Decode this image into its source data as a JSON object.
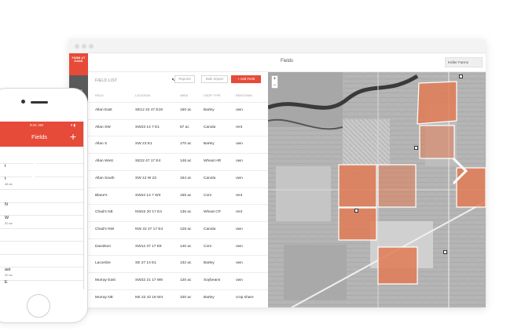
{
  "window": {
    "title": "Fields",
    "farm_selector": "Keller Farms"
  },
  "brand": {
    "logo_text": "FARM AT HAND"
  },
  "list": {
    "title": "FIELD LIST",
    "buttons": {
      "reports": "Reports",
      "bulk_import": "Bulk Import",
      "add_field": "+ Add Field"
    },
    "columns": [
      "FIELD",
      "LOCATION",
      "AREA",
      "CROP TYPE",
      "RENT/OWN"
    ],
    "rows": [
      [
        "Allan East",
        "SE12 22 47 E19",
        "160 ac",
        "Barley",
        "own"
      ],
      [
        "Allan SW",
        "SW23 14 7 E1",
        "87 ac",
        "Canola",
        "rent"
      ],
      [
        "Allan S",
        "SW 23 E1",
        "170 ac",
        "Barley",
        "own"
      ],
      [
        "Allan West",
        "SE22 47 17 E4",
        "148 ac",
        "Wheat HR",
        "own"
      ],
      [
        "Allan South",
        "SW 12 W 23",
        "154 ac",
        "Canola",
        "own"
      ],
      [
        "Blane's",
        "SW22 14 7 W3",
        "155 ac",
        "Corn",
        "rent"
      ],
      [
        "Chad's NE",
        "NW22 20 17 E4",
        "135 ac",
        "Wheat CP",
        "rent"
      ],
      [
        "Chad's NW",
        "NW 22 47 17 E4",
        "128 ac",
        "Canola",
        "own"
      ],
      [
        "Davidson",
        "SW12 37 17 E9",
        "140 ac",
        "Corn",
        "own"
      ],
      [
        "Lacombe",
        "SE 27 14 E1",
        "132 ac",
        "Barley",
        "own"
      ],
      [
        "Murray East",
        "SW22 21 17 W8",
        "120 ac",
        "Soybeans",
        "own"
      ],
      [
        "Murray NE",
        "NE 22 42 18 W4",
        "100 ac",
        "Barley",
        "crop share"
      ]
    ]
  },
  "map": {
    "zoom_in": "+",
    "zoom_out": "−"
  },
  "phone": {
    "status_time": "9:41 AM",
    "status_right": "▾ ▮",
    "title": "Fields",
    "add": "+",
    "rows": [
      {
        "name": "",
        "sub": ""
      },
      {
        "name": "t",
        "sub": ""
      },
      {
        "name": "t",
        "sub": "48 ac"
      },
      {
        "name": "",
        "sub": ""
      },
      {
        "name": "N",
        "sub": ""
      },
      {
        "name": "W",
        "sub": "20 ac"
      },
      {
        "name": "",
        "sub": ""
      },
      {
        "name": "",
        "sub": ""
      },
      {
        "name": "",
        "sub": ""
      },
      {
        "name": "ast",
        "sub": "20 ac"
      },
      {
        "name": "E",
        "sub": ""
      }
    ]
  },
  "colors": {
    "accent": "#e64a38",
    "field_overlay": "#e07b55"
  }
}
